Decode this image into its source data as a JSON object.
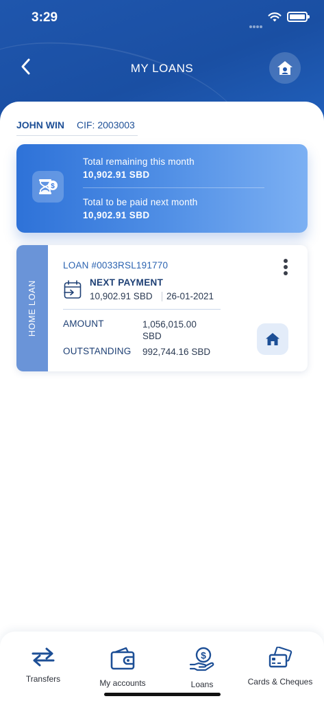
{
  "status_bar": {
    "time": "3:29"
  },
  "header": {
    "title": "MY LOANS"
  },
  "customer": {
    "name": "JOHN WIN",
    "cif": "CIF: 2003003"
  },
  "summary": {
    "this_month_label": "Total remaining this month",
    "this_month_value": "10,902.91 SBD",
    "next_month_label": "Total to be paid next month",
    "next_month_value": "10,902.91 SBD"
  },
  "loan": {
    "type": "HOME LOAN",
    "number": "LOAN #0033RSL191770",
    "next_payment_label": "NEXT PAYMENT",
    "next_payment_amount": "10,902.91 SBD",
    "next_payment_date": "26-01-2021",
    "amount_label": "AMOUNT",
    "amount_value_line1": "1,056,015.00",
    "amount_value_line2": "SBD",
    "outstanding_label": "OUTSTANDING",
    "outstanding_value": "992,744.16 SBD"
  },
  "nav": {
    "items": [
      {
        "label": "Transfers",
        "icon": "transfer-arrows-icon"
      },
      {
        "label": "My accounts",
        "icon": "wallet-icon"
      },
      {
        "label": "Loans",
        "icon": "loan-hand-coin-icon"
      },
      {
        "label": "Cards & Cheques",
        "icon": "cards-icon"
      }
    ]
  },
  "colors": {
    "brand_blue": "#1f56ad",
    "accent_blue": "#2a62b0",
    "side_stripe": "#6a94d8"
  }
}
